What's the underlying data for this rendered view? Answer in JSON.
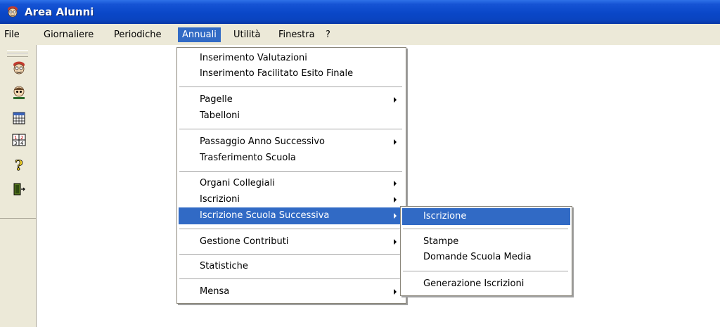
{
  "window": {
    "title": "Area Alunni",
    "title_icon": "app-face-icon"
  },
  "menubar": {
    "items": [
      {
        "label": "File"
      },
      {
        "label": "Giornaliere"
      },
      {
        "label": "Periodiche"
      },
      {
        "label": "Annuali",
        "active": true
      },
      {
        "label": "Utilità"
      },
      {
        "label": "Finestra"
      },
      {
        "label": "?"
      }
    ]
  },
  "toolbar": {
    "buttons": [
      {
        "icon": "student-face-icon"
      },
      {
        "icon": "teacher-face-icon"
      },
      {
        "icon": "calendar-grid-icon"
      },
      {
        "icon": "schedule-table-icon"
      },
      {
        "icon": "help-question-icon"
      },
      {
        "icon": "exit-door-icon"
      }
    ]
  },
  "annuali_menu": {
    "items": [
      {
        "label": "Inserimento Valutazioni"
      },
      {
        "label": "Inserimento Facilitato Esito Finale"
      },
      {
        "label": "Pagelle",
        "submenu": true
      },
      {
        "label": "Tabelloni"
      },
      {
        "label": "Passaggio Anno Successivo",
        "submenu": true
      },
      {
        "label": "Trasferimento Scuola"
      },
      {
        "label": "Organi Collegiali",
        "submenu": true
      },
      {
        "label": "Iscrizioni",
        "submenu": true
      },
      {
        "label": "Iscrizione Scuola Successiva",
        "submenu": true,
        "highlighted": true
      },
      {
        "label": "Gestione Contributi",
        "submenu": true
      },
      {
        "label": "Statistiche"
      },
      {
        "label": "Mensa",
        "submenu": true
      }
    ]
  },
  "iscrizione_submenu": {
    "items": [
      {
        "label": "Iscrizione",
        "highlighted": true
      },
      {
        "label": "Stampe"
      },
      {
        "label": "Domande Scuola Media"
      },
      {
        "label": "Generazione Iscrizioni"
      }
    ]
  },
  "colors": {
    "highlight": "#316ac5",
    "menubar_bg": "#ece9d8",
    "titlebar": "#0a47c8"
  }
}
